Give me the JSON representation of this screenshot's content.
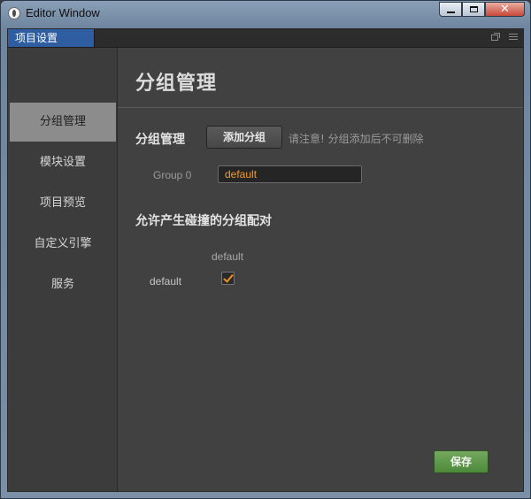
{
  "window": {
    "title": "Editor Window"
  },
  "tab": {
    "label": "项目设置"
  },
  "sidebar": {
    "items": [
      {
        "label": "分组管理",
        "active": true
      },
      {
        "label": "模块设置",
        "active": false
      },
      {
        "label": "项目预览",
        "active": false
      },
      {
        "label": "自定义引擎",
        "active": false
      },
      {
        "label": "服务",
        "active": false
      }
    ]
  },
  "main": {
    "title": "分组管理",
    "group_section": {
      "label": "分组管理",
      "add_button": "添加分组",
      "note": "请注意! 分组添加后不可删除"
    },
    "groups": [
      {
        "label": "Group 0",
        "value": "default"
      }
    ],
    "collision": {
      "title": "允许产生碰撞的分组配对",
      "column_header": "default",
      "row_label": "default",
      "checked": true
    },
    "save_button": "保存"
  },
  "colors": {
    "accent_tab": "#2f5da2",
    "save_green": "#5a9646",
    "input_text": "#f39a2c"
  }
}
